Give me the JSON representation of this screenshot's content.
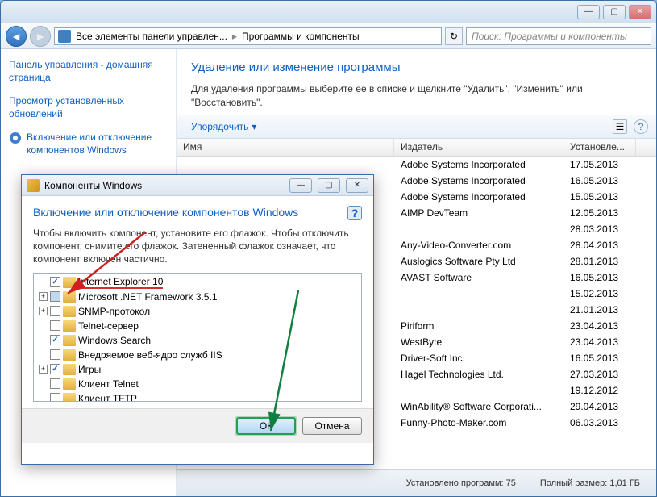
{
  "titlebar": {
    "minimize": "—",
    "maximize": "▢",
    "close": "✕"
  },
  "breadcrumb": {
    "seg1": "Все элементы панели управлен...",
    "seg2": "Программы и компоненты"
  },
  "search": {
    "placeholder": "Поиск: Программы и компоненты"
  },
  "sidebar": {
    "home": "Панель управления - домашняя страница",
    "updates": "Просмотр установленных обновлений",
    "features": "Включение или отключение компонентов Windows"
  },
  "main": {
    "title": "Удаление или изменение программы",
    "desc": "Для удаления программы выберите ее в списке и щелкните \"Удалить\", \"Изменить\" или \"Восстановить\"."
  },
  "toolbar": {
    "organize": "Упорядочить"
  },
  "columns": {
    "name": "Имя",
    "publisher": "Издатель",
    "installed": "Установле..."
  },
  "rows": [
    {
      "pub": "Adobe Systems Incorporated",
      "date": "17.05.2013"
    },
    {
      "pub": "Adobe Systems Incorporated",
      "date": "16.05.2013"
    },
    {
      "pub": "Adobe Systems Incorporated",
      "date": "15.05.2013"
    },
    {
      "pub": "AIMP DevTeam",
      "date": "12.05.2013"
    },
    {
      "pub": "",
      "date": "28.03.2013"
    },
    {
      "pub": "Any-Video-Converter.com",
      "date": "28.04.2013"
    },
    {
      "pub": "Auslogics Software Pty Ltd",
      "date": "28.01.2013"
    },
    {
      "pub": "AVAST Software",
      "date": "16.05.2013"
    },
    {
      "pub": "",
      "date": "15.02.2013"
    },
    {
      "pub": "",
      "date": "21.01.2013"
    },
    {
      "pub": "Piriform",
      "date": "23.04.2013"
    },
    {
      "pub": "WestByte",
      "date": "23.04.2013"
    },
    {
      "pub": "Driver-Soft Inc.",
      "date": "16.05.2013"
    },
    {
      "pub": "Hagel Technologies Ltd.",
      "date": "27.03.2013"
    },
    {
      "pub": "",
      "date": "19.12.2012"
    },
    {
      "pub": "WinAbility® Software Corporati...",
      "date": "29.04.2013"
    },
    {
      "pub": "Funny-Photo-Maker.com",
      "date": "06.03.2013"
    }
  ],
  "status": {
    "count_label": "Установлено программ:",
    "count": "75",
    "size_label": "Полный размер:",
    "size": "1,01 ГБ"
  },
  "dialog": {
    "title": "Компоненты Windows",
    "heading": "Включение или отключение компонентов Windows",
    "desc": "Чтобы включить компонент, установите его флажок. Чтобы отключить компонент, снимите его флажок. Затененный флажок означает, что компонент включен частично.",
    "items": [
      {
        "exp": "",
        "chk": "checked",
        "label": "Internet Explorer 10",
        "hl": true
      },
      {
        "exp": "+",
        "chk": "partial",
        "label": "Microsoft .NET Framework 3.5.1"
      },
      {
        "exp": "+",
        "chk": "",
        "label": "SNMP-протокол"
      },
      {
        "exp": "",
        "chk": "",
        "label": "Telnet-сервер"
      },
      {
        "exp": "",
        "chk": "checked",
        "label": "Windows Search"
      },
      {
        "exp": "",
        "chk": "",
        "label": "Внедряемое веб-ядро служб IIS"
      },
      {
        "exp": "+",
        "chk": "checked",
        "label": "Игры"
      },
      {
        "exp": "",
        "chk": "",
        "label": "Клиент Telnet"
      },
      {
        "exp": "",
        "chk": "",
        "label": "Клиент TFTP"
      }
    ],
    "ok": "ОК",
    "cancel": "Отмена"
  }
}
